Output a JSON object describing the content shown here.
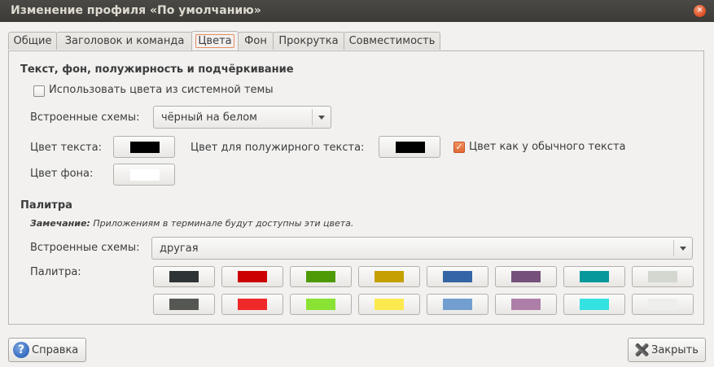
{
  "window": {
    "title": "Изменение профиля «По умолчанию»"
  },
  "tabs": [
    {
      "label": "Общие"
    },
    {
      "label": "Заголовок и команда"
    },
    {
      "label": "Цвета"
    },
    {
      "label": "Фон"
    },
    {
      "label": "Прокрутка"
    },
    {
      "label": "Совместимость"
    }
  ],
  "colors_section": {
    "heading": "Текст, фон, полужирность и подчёркивание",
    "use_system_theme": {
      "label": "Использовать цвета из системной темы",
      "checked": false
    },
    "builtin_schemes": {
      "label": "Встроенные схемы:",
      "value": "чёрный на белом"
    },
    "text_color": {
      "label": "Цвет текста:",
      "color": "#000000"
    },
    "bold_color": {
      "label": "Цвет для полужирного текста:",
      "color": "#000000"
    },
    "same_as_text": {
      "label": "Цвет как у обычного текста",
      "checked": true
    },
    "bg_color": {
      "label": "Цвет фона:",
      "color": "#ffffff"
    }
  },
  "palette_section": {
    "heading": "Палитра",
    "note_label": "Замечание:",
    "note_text": " Приложениям в терминале будут доступны эти цвета.",
    "builtin_schemes": {
      "label": "Встроенные схемы:",
      "value": "другая"
    },
    "palette_label": "Палитра:",
    "colors": [
      "#2e3436",
      "#cc0000",
      "#4e9a06",
      "#c4a000",
      "#3465a4",
      "#75507b",
      "#06989a",
      "#d3d7cf",
      "#555753",
      "#ef2929",
      "#8ae234",
      "#fce94f",
      "#729fcf",
      "#ad7fa8",
      "#34e2e2",
      "#eeeeec"
    ]
  },
  "footer": {
    "help_label": "Справка",
    "close_label": "Закрыть"
  }
}
